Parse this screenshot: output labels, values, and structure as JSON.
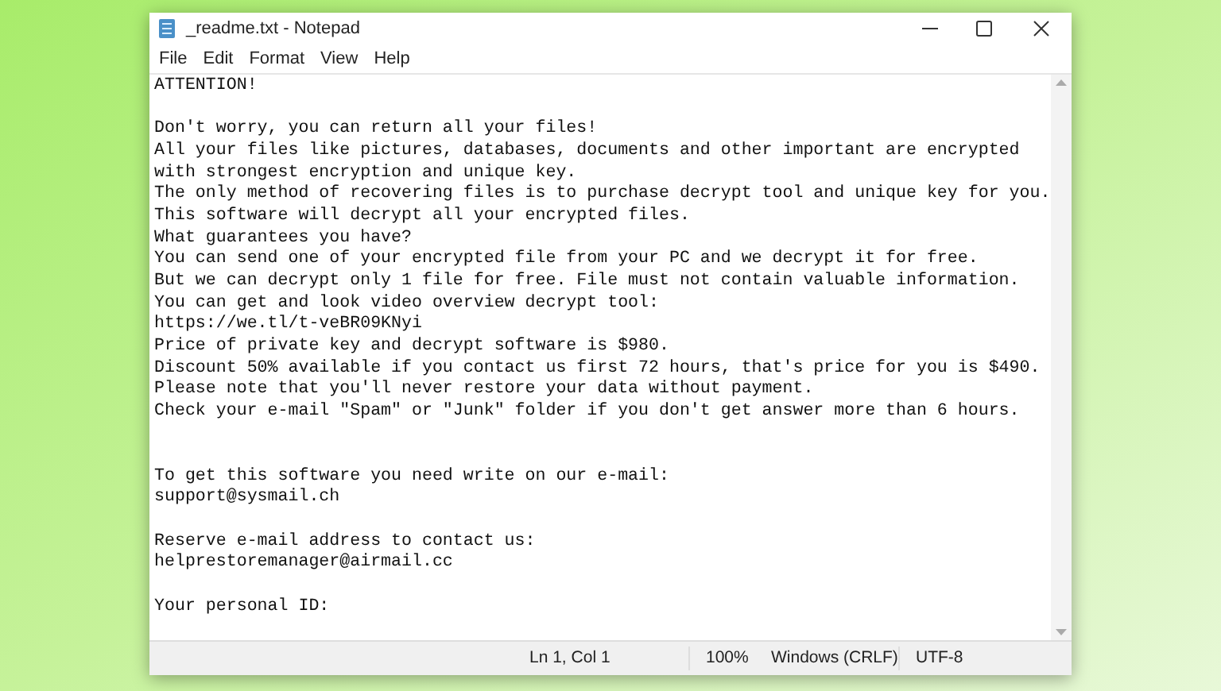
{
  "window": {
    "title": "_readme.txt - Notepad"
  },
  "menu": [
    "File",
    "Edit",
    "Format",
    "View",
    "Help"
  ],
  "document_text": "ATTENTION!\n\nDon't worry, you can return all your files!\nAll your files like pictures, databases, documents and other important are encrypted\nwith strongest encryption and unique key.\nThe only method of recovering files is to purchase decrypt tool and unique key for you.\nThis software will decrypt all your encrypted files.\nWhat guarantees you have?\nYou can send one of your encrypted file from your PC and we decrypt it for free.\nBut we can decrypt only 1 file for free. File must not contain valuable information.\nYou can get and look video overview decrypt tool:\nhttps://we.tl/t-veBR09KNyi\nPrice of private key and decrypt software is $980.\nDiscount 50% available if you contact us first 72 hours, that's price for you is $490.\nPlease note that you'll never restore your data without payment.\nCheck your e-mail \"Spam\" or \"Junk\" folder if you don't get answer more than 6 hours.\n\n\nTo get this software you need write on our e-mail:\nsupport@sysmail.ch\n\nReserve e-mail address to contact us:\nhelprestoremanager@airmail.cc\n\nYour personal ID:",
  "status_bar": {
    "position": "Ln 1, Col 1",
    "zoom": "100%",
    "line_ending": "Windows (CRLF)",
    "encoding": "UTF-8"
  }
}
